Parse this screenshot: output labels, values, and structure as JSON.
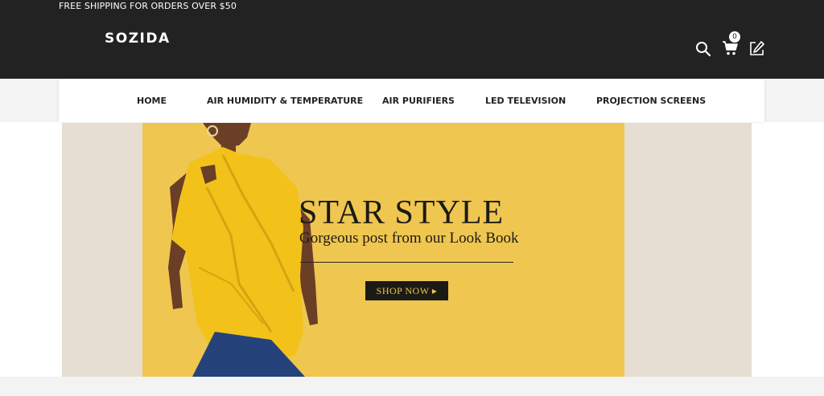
{
  "header": {
    "promo": "FREE SHIPPING FOR ORDERS OVER $50",
    "logo": "SOZIDA",
    "cart_count": "0",
    "icons": [
      "search-icon",
      "cart-icon",
      "edit-icon"
    ]
  },
  "nav": {
    "items": [
      {
        "label": "HOME"
      },
      {
        "label": "AIR HUMIDITY & TEMPERATURE"
      },
      {
        "label": "AIR PURIFIERS"
      },
      {
        "label": "LED TELEVISION"
      },
      {
        "label": "PROJECTION SCREENS"
      }
    ]
  },
  "banner": {
    "title": "STAR STYLE",
    "subtitle": "Gorgeous post from our Look Book",
    "cta": "SHOP NOW ▸"
  },
  "colors": {
    "header_bg": "#222222",
    "banner_yellow": "#efc650",
    "banner_beige": "#e6ded0"
  }
}
